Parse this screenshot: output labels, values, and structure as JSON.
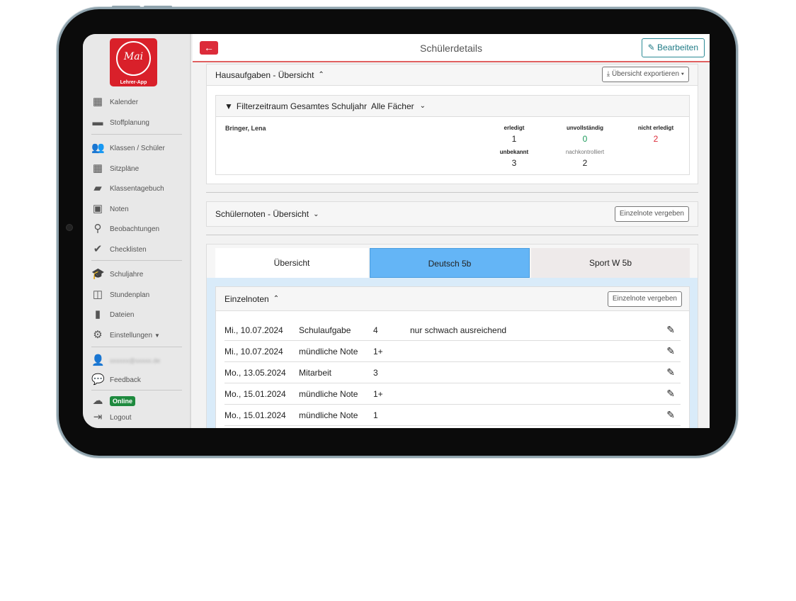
{
  "app": {
    "logo_text": "Mai",
    "logo_sub": "Lehrer-App"
  },
  "sidebar": {
    "items": [
      {
        "label": "Kalender",
        "icon": "calendar-icon"
      },
      {
        "label": "Stoffplanung",
        "icon": "archive-icon"
      },
      {
        "label": "Klassen / Schüler",
        "icon": "users-icon"
      },
      {
        "label": "Sitzpläne",
        "icon": "grid-icon"
      },
      {
        "label": "Klassentagebuch",
        "icon": "book-icon"
      },
      {
        "label": "Noten",
        "icon": "contact-book-icon"
      },
      {
        "label": "Beobachtungen",
        "icon": "binoculars-icon"
      },
      {
        "label": "Checklisten",
        "icon": "check-circle-icon"
      },
      {
        "label": "Schuljahre",
        "icon": "graduation-cap-icon"
      },
      {
        "label": "Stundenplan",
        "icon": "columns-icon"
      },
      {
        "label": "Dateien",
        "icon": "file-icon"
      },
      {
        "label": "Einstellungen",
        "icon": "gear-icon"
      },
      {
        "label": "Feedback",
        "icon": "comment-icon"
      },
      {
        "label": "Logout",
        "icon": "logout-icon"
      }
    ],
    "status": "Online"
  },
  "header": {
    "title": "Schülerdetails",
    "edit_label": "Bearbeiten"
  },
  "homework": {
    "title": "Hausaufgaben - Übersicht",
    "export_label": "Übersicht exportieren",
    "filter": "Filterzeitraum Gesamtes Schuljahr  Alle Fächer",
    "student": "Bringer, Lena",
    "stats": [
      {
        "label": "erledigt",
        "value": "1"
      },
      {
        "label": "unvollständig",
        "value": "0"
      },
      {
        "label": "nicht erledigt",
        "value": "2"
      },
      {
        "label": "unbekannt",
        "value": "3"
      },
      {
        "label": "nachkontrolliert",
        "value": "2"
      }
    ]
  },
  "grades": {
    "title": "Schülernoten - Übersicht",
    "button": "Einzelnote vergeben"
  },
  "tabs": [
    {
      "label": "Übersicht"
    },
    {
      "label": "Deutsch 5b",
      "active": true
    },
    {
      "label": "Sport W 5b"
    }
  ],
  "single": {
    "title": "Einzelnoten",
    "button": "Einzelnote vergeben",
    "rows": [
      {
        "date": "Mi., 10.07.2024",
        "type": "Schulaufgabe",
        "grade": "4",
        "note": "nur schwach ausreichend"
      },
      {
        "date": "Mi., 10.07.2024",
        "type": "mündliche Note",
        "grade": "1+",
        "note": ""
      },
      {
        "date": "Mo., 13.05.2024",
        "type": "Mitarbeit",
        "grade": "3",
        "note": ""
      },
      {
        "date": "Mo., 15.01.2024",
        "type": "mündliche Note",
        "grade": "1+",
        "note": ""
      },
      {
        "date": "Mo., 15.01.2024",
        "type": "mündliche Note",
        "grade": "1",
        "note": ""
      }
    ]
  },
  "colors": {
    "accent": "#dc2c3a",
    "active_tab": "#64b5f6",
    "online": "#1e8a3e",
    "teal": "#1f7b86"
  }
}
